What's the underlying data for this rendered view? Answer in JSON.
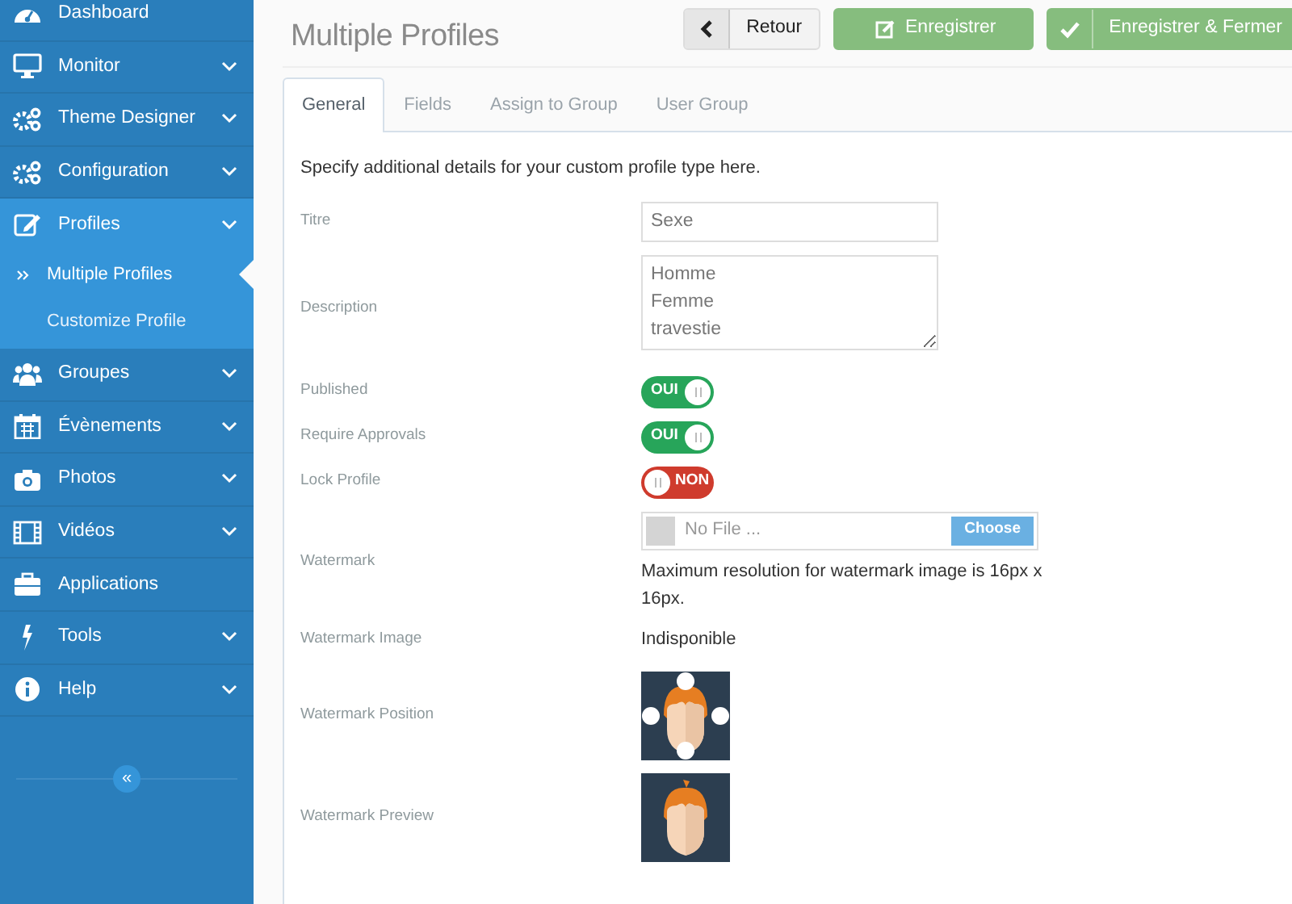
{
  "sidebar": {
    "items": [
      {
        "label": "Dashboard",
        "expandable": false,
        "selected": false
      },
      {
        "label": "Monitor",
        "expandable": true,
        "selected": false
      },
      {
        "label": "Theme Designer",
        "expandable": true,
        "selected": false
      },
      {
        "label": "Configuration",
        "expandable": true,
        "selected": false
      },
      {
        "label": "Profiles",
        "expandable": true,
        "selected": true,
        "expanded": true,
        "children": [
          {
            "label": "Multiple Profiles",
            "selected": true
          },
          {
            "label": "Customize Profile",
            "selected": false
          }
        ]
      },
      {
        "label": "Groupes",
        "expandable": true,
        "selected": false
      },
      {
        "label": "Évènements",
        "expandable": true,
        "selected": false
      },
      {
        "label": "Photos",
        "expandable": true,
        "selected": false
      },
      {
        "label": "Vidéos",
        "expandable": true,
        "selected": false
      },
      {
        "label": "Applications",
        "expandable": false,
        "selected": false
      },
      {
        "label": "Tools",
        "expandable": true,
        "selected": false
      },
      {
        "label": "Help",
        "expandable": true,
        "selected": false
      }
    ],
    "collapse_button": "«"
  },
  "page": {
    "title": "Multiple Profiles",
    "buttons": [
      {
        "label": "Retour",
        "kind": "back"
      },
      {
        "label": "Enregistrer",
        "kind": "save"
      },
      {
        "label": "Enregistrer & Fermer",
        "kind": "save-close"
      }
    ]
  },
  "tabs": [
    {
      "label": "General",
      "selected": true
    },
    {
      "label": "Fields",
      "selected": false
    },
    {
      "label": "Assign to Group",
      "selected": false
    },
    {
      "label": "User Group",
      "selected": false
    }
  ],
  "intro": "Specify additional details for your custom profile type here.",
  "fields": [
    {
      "label": "Titre",
      "kind": "text",
      "value": "Sexe"
    },
    {
      "label": "Description",
      "kind": "textarea",
      "value": "Homme\nFemme\ntravestie"
    },
    {
      "label": "Published",
      "kind": "toggle",
      "on": true,
      "text": "OUI"
    },
    {
      "label": "Require Approvals",
      "kind": "toggle",
      "on": true,
      "text": "OUI"
    },
    {
      "label": "Lock Profile",
      "kind": "toggle",
      "on": false,
      "text": "NON"
    },
    {
      "label": "Watermark",
      "kind": "file",
      "placeholder": "No File ...",
      "button": "Choose",
      "help": "Maximum resolution for watermark image is 16px x 16px."
    },
    {
      "label": "Watermark Image",
      "kind": "static",
      "value": "Indisponible"
    },
    {
      "label": "Watermark Position",
      "kind": "position"
    },
    {
      "label": "Watermark Preview",
      "kind": "preview"
    }
  ]
}
